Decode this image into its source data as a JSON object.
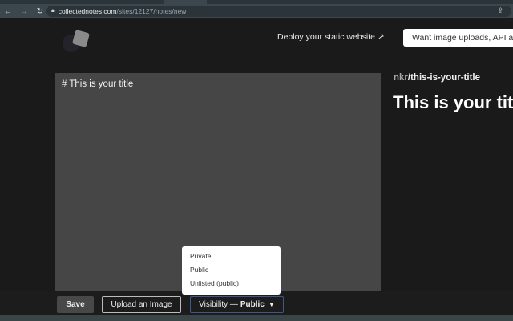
{
  "browser": {
    "url_domain": "collectednotes.com",
    "url_path": "/sites/12127/notes/new"
  },
  "header": {
    "deploy_link": "Deploy your static website ↗",
    "upsell_button": "Want image uploads, API access?"
  },
  "editor": {
    "content": "# This is your title"
  },
  "preview": {
    "site": "nkr",
    "slug": "/this-is-your-title",
    "title": "This is your title"
  },
  "toolbar": {
    "save": "Save",
    "upload": "Upload an Image",
    "visibility_label": "Visibility —",
    "visibility_value": "Public"
  },
  "visibility_menu": [
    "Private",
    "Public",
    "Unlisted (public)"
  ]
}
